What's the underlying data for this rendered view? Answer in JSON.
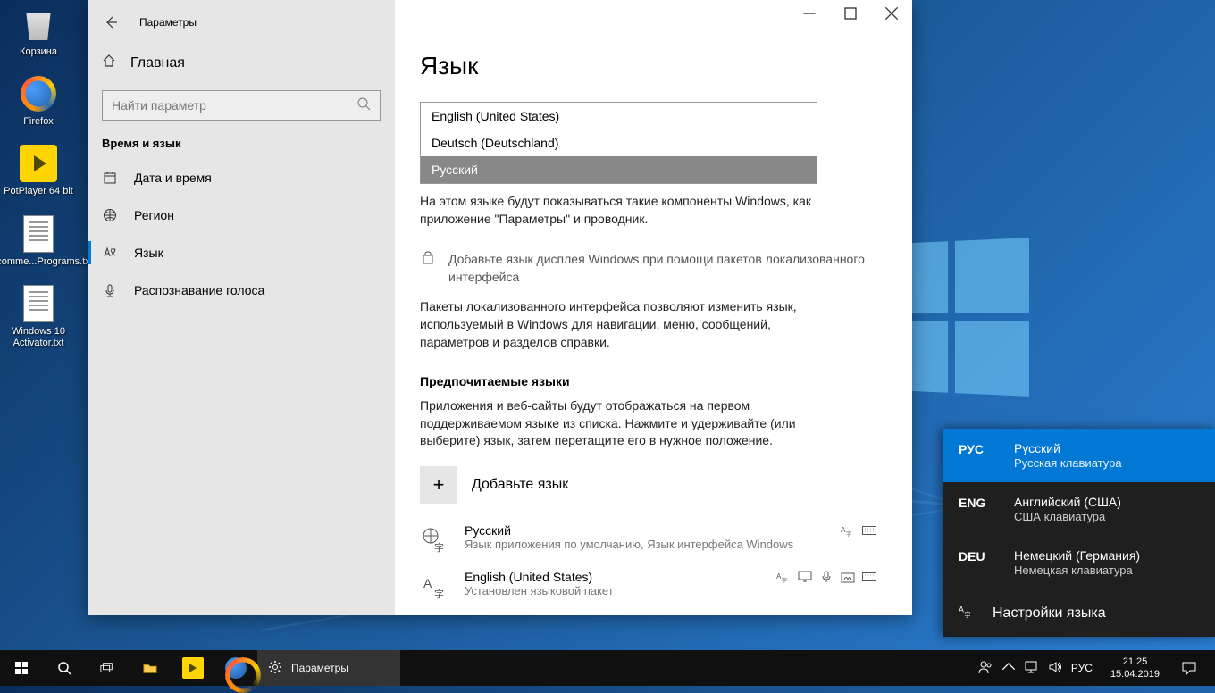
{
  "desktop": {
    "icons": [
      {
        "label": "Корзина"
      },
      {
        "label": "Firefox"
      },
      {
        "label": "PotPlayer 64 bit"
      },
      {
        "label": "Recomme...Programs.txt"
      },
      {
        "label": "Windows 10 Activator.txt"
      }
    ]
  },
  "settings": {
    "app_title": "Параметры",
    "home": "Главная",
    "search_placeholder": "Найти параметр",
    "section": "Время и язык",
    "nav": {
      "datetime": "Дата и время",
      "region": "Регион",
      "language": "Язык",
      "speech": "Распознавание голоса"
    },
    "page_title": "Язык",
    "dropdown": {
      "opt1": "English (United States)",
      "opt2": "Deutsch (Deutschland)",
      "opt3": "Русский"
    },
    "display_lang_help": "На этом языке будут показываться такие компоненты Windows, как приложение \"Параметры\" и проводник.",
    "store_link": "Добавьте язык дисплея Windows при помощи пакетов локализованного интерфейса",
    "lip_help": "Пакеты локализованного интерфейса позволяют изменить язык, используемый в Windows для навигации, меню, сообщений, параметров и разделов справки.",
    "preferred_title": "Предпочитаемые языки",
    "preferred_help": "Приложения и веб-сайты будут отображаться на первом поддерживаемом языке из списка. Нажмите и удерживайте (или выберите) язык, затем перетащите его в нужное положение.",
    "add_lang": "Добавьте язык",
    "langs": [
      {
        "name": "Русский",
        "sub": "Язык приложения по умолчанию, Язык интерфейса Windows"
      },
      {
        "name": "English (United States)",
        "sub": "Установлен языковой пакет"
      }
    ]
  },
  "lang_flyout": {
    "items": [
      {
        "code": "РУС",
        "name": "Русский",
        "sub": "Русская клавиатура"
      },
      {
        "code": "ENG",
        "name": "Английский (США)",
        "sub": "США клавиатура"
      },
      {
        "code": "DEU",
        "name": "Немецкий (Германия)",
        "sub": "Немецкая клавиатура"
      }
    ],
    "settings": "Настройки языка"
  },
  "taskbar": {
    "task": "Параметры",
    "ime": "РУС",
    "time": "21:25",
    "date": "15.04.2019"
  }
}
